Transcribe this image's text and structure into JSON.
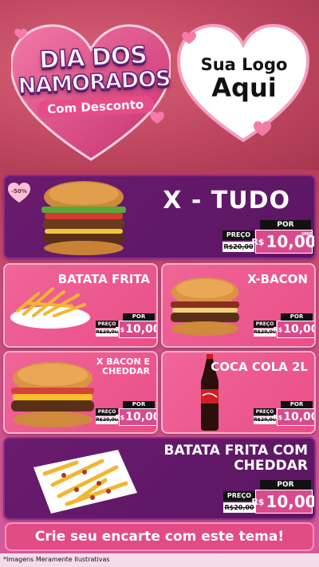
{
  "header": {
    "title_line1": "DIA DOS",
    "title_line2": "NAMORADOS",
    "title_sub": "Com Desconto",
    "logo_line1": "Sua Logo",
    "logo_line2": "Aqui"
  },
  "badge": "-50%",
  "products": [
    {
      "name": "X - TUDO",
      "preco_label": "PREÇO",
      "old_price": "R$20,00",
      "por_label": "POR",
      "currency": "R$",
      "new_price": "10,00",
      "unid": "UNID"
    },
    {
      "name": "BATATA FRITA",
      "preco_label": "PREÇO",
      "old_price": "R$20,00",
      "por_label": "POR",
      "currency": "R$",
      "new_price": "10,00",
      "unid": "UNID"
    },
    {
      "name": "X-BACON",
      "preco_label": "PREÇO",
      "old_price": "R$20,00",
      "por_label": "POR",
      "currency": "R$",
      "new_price": "10,00",
      "unid": "UNID"
    },
    {
      "name": "X BACON E CHEDDAR",
      "preco_label": "PREÇO",
      "old_price": "R$20,00",
      "por_label": "POR",
      "currency": "R$",
      "new_price": "10,00",
      "unid": "UNID"
    },
    {
      "name": "COCA COLA 2L",
      "preco_label": "PREÇO",
      "old_price": "R$20,00",
      "por_label": "POR",
      "currency": "R$",
      "new_price": "10,00",
      "unid": "UNID"
    },
    {
      "name": "BATATA FRITA COM CHEDDAR",
      "preco_label": "PREÇO",
      "old_price": "R$20,00",
      "por_label": "POR",
      "currency": "R$",
      "new_price": "10,00",
      "unid": "UNID"
    }
  ],
  "cta": "Crie seu encarte com este tema!",
  "disclaimer": "*Imagens Meramente Ilustrativas",
  "colors": {
    "purple_card": "#6a1b6e",
    "pink_card": "#ee5c93",
    "price_pink": "#d94a8c",
    "header_red": "#c24a62"
  }
}
